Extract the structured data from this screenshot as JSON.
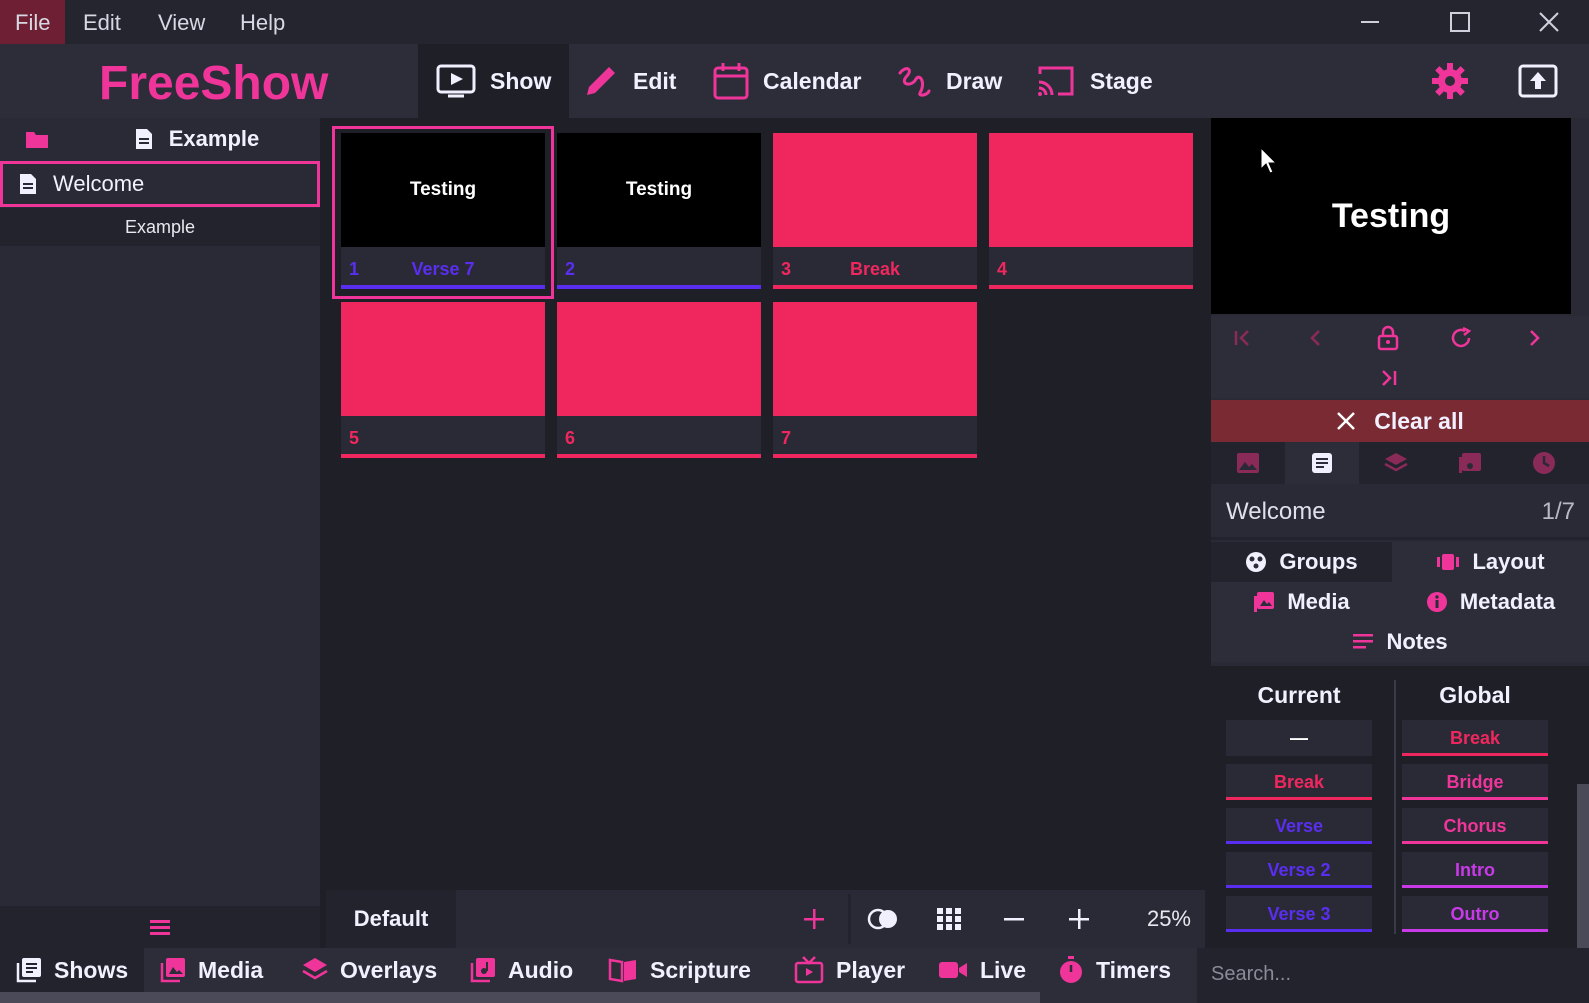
{
  "menu": {
    "items": [
      "File",
      "Edit",
      "View",
      "Help"
    ]
  },
  "app": {
    "logo": "FreeShow"
  },
  "top_tabs": [
    {
      "label": "Show",
      "icon": "play-screen-icon"
    },
    {
      "label": "Edit",
      "icon": "pencil-icon"
    },
    {
      "label": "Calendar",
      "icon": "calendar-icon"
    },
    {
      "label": "Draw",
      "icon": "draw-icon"
    },
    {
      "label": "Stage",
      "icon": "cast-icon"
    }
  ],
  "left": {
    "tab_label": "Example",
    "selected_show": "Welcome",
    "category": "Example"
  },
  "slides": [
    {
      "number": "1",
      "text": "Testing",
      "group": "Verse 7",
      "group_color": "#5a2ef0",
      "bg": "#000000"
    },
    {
      "number": "2",
      "text": "Testing",
      "group": "",
      "group_color": "#5a2ef0",
      "bg": "#000000"
    },
    {
      "number": "3",
      "text": "",
      "group": "Break",
      "group_color": "#f0275e",
      "bg": "#f0275e"
    },
    {
      "number": "4",
      "text": "",
      "group": "",
      "group_color": "#f0275e",
      "bg": "#f0275e"
    },
    {
      "number": "5",
      "text": "",
      "group": "",
      "group_color": "#f0275e",
      "bg": "#f0275e"
    },
    {
      "number": "6",
      "text": "",
      "group": "",
      "group_color": "#f0275e",
      "bg": "#f0275e"
    },
    {
      "number": "7",
      "text": "",
      "group": "",
      "group_color": "#f0275e",
      "bg": "#f0275e"
    }
  ],
  "main_bottom": {
    "layout_name": "Default",
    "zoom": "25%"
  },
  "preview": {
    "text": "Testing"
  },
  "right": {
    "clear_all": "Clear all",
    "show_name": "Welcome",
    "slide_count": "1/7",
    "subtabs": {
      "groups": "Groups",
      "layout": "Layout",
      "media": "Media",
      "metadata": "Metadata",
      "notes": "Notes"
    },
    "current_header": "Current",
    "global_header": "Global",
    "current_groups": [
      {
        "label": "—",
        "color": "#ffffff",
        "line": "#2a2a36"
      },
      {
        "label": "Break",
        "color": "#f0275e",
        "line": "#f0275e"
      },
      {
        "label": "Verse",
        "color": "#5a2ef0",
        "line": "#5a2ef0"
      },
      {
        "label": "Verse 2",
        "color": "#5a2ef0",
        "line": "#5a2ef0"
      },
      {
        "label": "Verse 3",
        "color": "#5a2ef0",
        "line": "#5a2ef0"
      }
    ],
    "global_groups": [
      {
        "label": "Break",
        "color": "#f0275e",
        "line": "#f0275e"
      },
      {
        "label": "Bridge",
        "color": "#f0359a",
        "line": "#f0359a"
      },
      {
        "label": "Chorus",
        "color": "#f0359a",
        "line": "#f0359a"
      },
      {
        "label": "Intro",
        "color": "#c83ae8",
        "line": "#c83ae8"
      },
      {
        "label": "Outro",
        "color": "#c83ae8",
        "line": "#c83ae8"
      }
    ]
  },
  "drawer_tabs": [
    {
      "label": "Shows",
      "icon": "shows-icon"
    },
    {
      "label": "Media",
      "icon": "image-icon"
    },
    {
      "label": "Overlays",
      "icon": "layers-icon"
    },
    {
      "label": "Audio",
      "icon": "music-icon"
    },
    {
      "label": "Scripture",
      "icon": "book-icon"
    },
    {
      "label": "Player",
      "icon": "tv-icon"
    },
    {
      "label": "Live",
      "icon": "camera-icon"
    },
    {
      "label": "Timers",
      "icon": "timer-icon"
    }
  ],
  "search": {
    "placeholder": "Search..."
  },
  "colors": {
    "accent": "#f0359a",
    "red": "#f0275e",
    "violet": "#5a2ef0"
  }
}
